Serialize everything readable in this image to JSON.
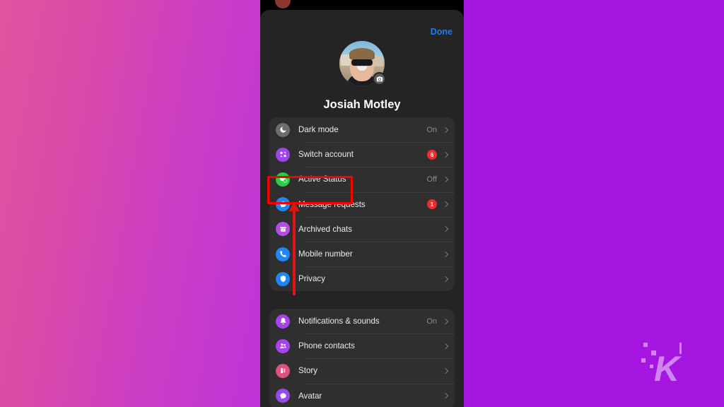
{
  "background": {
    "left_gradient_from": "#e0549f",
    "left_gradient_to": "#be33d8",
    "right_color": "#a517e0",
    "watermark_letter": "K"
  },
  "phone": {
    "done_label": "Done",
    "user_name": "Josiah Motley",
    "avatar_name": "profile-photo",
    "camera_icon": "camera-icon"
  },
  "menu_groups": [
    {
      "items": [
        {
          "label": "Dark mode",
          "value": "On",
          "badge": "",
          "icon": "moon-icon",
          "icon_color": "#6d6d6d"
        },
        {
          "label": "Switch account",
          "value": "",
          "badge": "6",
          "icon": "switch-icon",
          "icon_color": "#9b47e8"
        },
        {
          "label": "Active Status",
          "value": "Off",
          "badge": "",
          "icon": "active-status-icon",
          "icon_color": "#2ecc45"
        },
        {
          "label": "Message requests",
          "value": "",
          "badge": "1",
          "icon": "chat-bubble-icon",
          "icon_color": "#1f86f5"
        },
        {
          "label": "Archived chats",
          "value": "",
          "badge": "",
          "icon": "archive-box-icon",
          "icon_color": "#b44ce6"
        },
        {
          "label": "Mobile number",
          "value": "",
          "badge": "",
          "icon": "phone-icon",
          "icon_color": "#1f86f5"
        },
        {
          "label": "Privacy",
          "value": "",
          "badge": "",
          "icon": "shield-icon",
          "icon_color": "#1f86f5"
        }
      ]
    },
    {
      "items": [
        {
          "label": "Notifications & sounds",
          "value": "On",
          "badge": "",
          "icon": "bell-icon",
          "icon_color": "#a742ef"
        },
        {
          "label": "Phone contacts",
          "value": "",
          "badge": "",
          "icon": "contacts-icon",
          "icon_color": "#a742ef"
        },
        {
          "label": "Story",
          "value": "",
          "badge": "",
          "icon": "story-icon",
          "icon_color": "#e0527e"
        },
        {
          "label": "Avatar",
          "value": "",
          "badge": "",
          "icon": "avatar-icon",
          "icon_color": "#9b47e8"
        }
      ]
    }
  ],
  "annotations": {
    "highlight_color": "#fc0000",
    "arrow_color": "#e01414",
    "highlighted_item": "Active Status"
  }
}
